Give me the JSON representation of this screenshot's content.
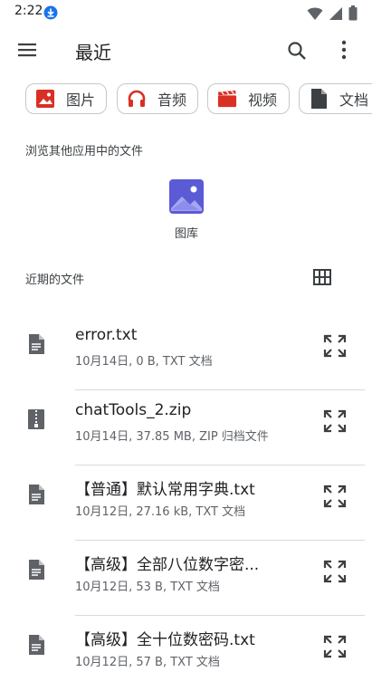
{
  "status": {
    "time": "2:22"
  },
  "appbar": {
    "title": "最近"
  },
  "chips": [
    {
      "label": "图片",
      "icon": "image-icon",
      "color": "#d93025"
    },
    {
      "label": "音频",
      "icon": "headphones-icon",
      "color": "#d93025"
    },
    {
      "label": "视频",
      "icon": "video-icon",
      "color": "#d93025"
    },
    {
      "label": "文档",
      "icon": "document-icon",
      "color": "#3c4043"
    }
  ],
  "browse_label": "浏览其他应用中的文件",
  "gallery": {
    "label": "图库",
    "color": "#5b5bd6"
  },
  "recent_label": "近期的文件",
  "files": [
    {
      "name": "error.txt",
      "meta": "10月14日, 0 B, TXT 文档",
      "icon": "text-file-icon"
    },
    {
      "name": "chatTools_2.zip",
      "meta": "10月14日, 37.85 MB, ZIP 归档文件",
      "icon": "zip-file-icon"
    },
    {
      "name": "【普通】默认常用字典.txt",
      "meta": "10月12日, 27.16 kB, TXT 文档",
      "icon": "text-file-icon"
    },
    {
      "name": "【高级】全部八位数字密...",
      "meta": "10月12日, 53 B, TXT 文档",
      "icon": "text-file-icon"
    },
    {
      "name": "【高级】全十位数密码.txt",
      "meta": "10月12日, 57 B, TXT 文档",
      "icon": "text-file-icon"
    }
  ]
}
